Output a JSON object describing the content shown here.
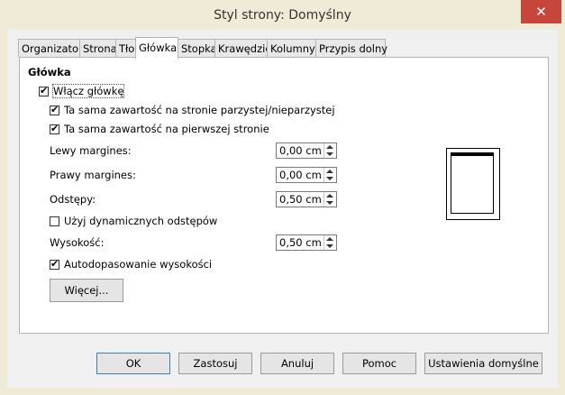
{
  "window": {
    "title": "Styl strony: Domyślny"
  },
  "tabs": [
    {
      "label": "Organizator"
    },
    {
      "label": "Strona"
    },
    {
      "label": "Tło"
    },
    {
      "label": "Główka"
    },
    {
      "label": "Stopka"
    },
    {
      "label": "Krawędzie"
    },
    {
      "label": "Kolumny"
    },
    {
      "label": "Przypis dolny"
    }
  ],
  "active_tab": "Główka",
  "section": {
    "title": "Główka",
    "enable_header": "Włącz główkę",
    "same_odd_even": "Ta sama zawartość na stronie parzystej/nieparzystej",
    "same_first_page": "Ta sama zawartość na pierwszej stronie",
    "left_margin": {
      "label": "Lewy margines:",
      "value": "0,00 cm"
    },
    "right_margin": {
      "label": "Prawy margines:",
      "value": "0,00 cm"
    },
    "spacing": {
      "label": "Odstępy:",
      "value": "0,50 cm"
    },
    "dynamic_spacing": "Użyj dynamicznych odstępów",
    "height": {
      "label": "Wysokość:",
      "value": "0,50 cm"
    },
    "autofit": "Autodopasowanie wysokości",
    "more_button": "Więcej..."
  },
  "buttons": {
    "ok": "OK",
    "apply": "Zastosuj",
    "cancel": "Anuluj",
    "help": "Pomoc",
    "reset": "Ustawienia domyślne"
  }
}
